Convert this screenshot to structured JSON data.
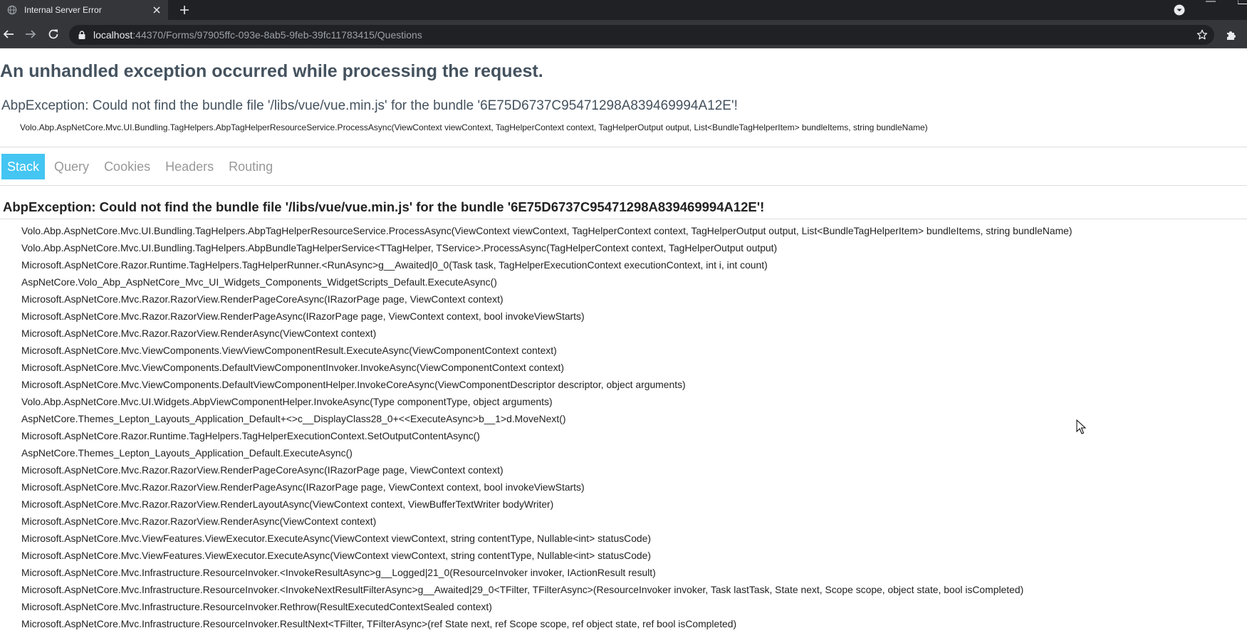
{
  "browser": {
    "tab_title": "Internal Server Error",
    "url_host": "localhost",
    "url_rest": ":44370/Forms/97905ffc-093e-8ab5-9feb-39fc11783415/Questions",
    "icons": [
      "globe-icon",
      "close-icon",
      "plus-icon",
      "tab-search-icon",
      "back-icon",
      "forward-icon",
      "reload-icon",
      "lock-icon",
      "star-icon",
      "extensions-icon"
    ]
  },
  "error": {
    "title": "An unhandled exception occurred while processing the request.",
    "message": "AbpException: Could not find the bundle file '/libs/vue/vue.min.js' for the bundle '6E75D6737C95471298A839469994A12E'!",
    "location": "Volo.Abp.AspNetCore.Mvc.UI.Bundling.TagHelpers.AbpTagHelperResourceService.ProcessAsync(ViewContext viewContext, TagHelperContext context, TagHelperOutput output, List<BundleTagHelperItem> bundleItems, string bundleName)"
  },
  "tabs": [
    "Stack",
    "Query",
    "Cookies",
    "Headers",
    "Routing"
  ],
  "stack": {
    "heading": "AbpException: Could not find the bundle file '/libs/vue/vue.min.js' for the bundle '6E75D6737C95471298A839469994A12E'!",
    "frames": [
      "Volo.Abp.AspNetCore.Mvc.UI.Bundling.TagHelpers.AbpTagHelperResourceService.ProcessAsync(ViewContext viewContext, TagHelperContext context, TagHelperOutput output, List<BundleTagHelperItem> bundleItems, string bundleName)",
      "Volo.Abp.AspNetCore.Mvc.UI.Bundling.TagHelpers.AbpBundleTagHelperService<TTagHelper, TService>.ProcessAsync(TagHelperContext context, TagHelperOutput output)",
      "Microsoft.AspNetCore.Razor.Runtime.TagHelpers.TagHelperRunner.<RunAsync>g__Awaited|0_0(Task task, TagHelperExecutionContext executionContext, int i, int count)",
      "AspNetCore.Volo_Abp_AspNetCore_Mvc_UI_Widgets_Components_WidgetScripts_Default.ExecuteAsync()",
      "Microsoft.AspNetCore.Mvc.Razor.RazorView.RenderPageCoreAsync(IRazorPage page, ViewContext context)",
      "Microsoft.AspNetCore.Mvc.Razor.RazorView.RenderPageAsync(IRazorPage page, ViewContext context, bool invokeViewStarts)",
      "Microsoft.AspNetCore.Mvc.Razor.RazorView.RenderAsync(ViewContext context)",
      "Microsoft.AspNetCore.Mvc.ViewComponents.ViewViewComponentResult.ExecuteAsync(ViewComponentContext context)",
      "Microsoft.AspNetCore.Mvc.ViewComponents.DefaultViewComponentInvoker.InvokeAsync(ViewComponentContext context)",
      "Microsoft.AspNetCore.Mvc.ViewComponents.DefaultViewComponentHelper.InvokeCoreAsync(ViewComponentDescriptor descriptor, object arguments)",
      "Volo.Abp.AspNetCore.Mvc.UI.Widgets.AbpViewComponentHelper.InvokeAsync(Type componentType, object arguments)",
      "AspNetCore.Themes_Lepton_Layouts_Application_Default+<>c__DisplayClass28_0+<<ExecuteAsync>b__1>d.MoveNext()",
      "Microsoft.AspNetCore.Razor.Runtime.TagHelpers.TagHelperExecutionContext.SetOutputContentAsync()",
      "AspNetCore.Themes_Lepton_Layouts_Application_Default.ExecuteAsync()",
      "Microsoft.AspNetCore.Mvc.Razor.RazorView.RenderPageCoreAsync(IRazorPage page, ViewContext context)",
      "Microsoft.AspNetCore.Mvc.Razor.RazorView.RenderPageAsync(IRazorPage page, ViewContext context, bool invokeViewStarts)",
      "Microsoft.AspNetCore.Mvc.Razor.RazorView.RenderLayoutAsync(ViewContext context, ViewBufferTextWriter bodyWriter)",
      "Microsoft.AspNetCore.Mvc.Razor.RazorView.RenderAsync(ViewContext context)",
      "Microsoft.AspNetCore.Mvc.ViewFeatures.ViewExecutor.ExecuteAsync(ViewContext viewContext, string contentType, Nullable<int> statusCode)",
      "Microsoft.AspNetCore.Mvc.ViewFeatures.ViewExecutor.ExecuteAsync(ViewContext viewContext, string contentType, Nullable<int> statusCode)",
      "Microsoft.AspNetCore.Mvc.Infrastructure.ResourceInvoker.<InvokeResultAsync>g__Logged|21_0(ResourceInvoker invoker, IActionResult result)",
      "Microsoft.AspNetCore.Mvc.Infrastructure.ResourceInvoker.<InvokeNextResultFilterAsync>g__Awaited|29_0<TFilter, TFilterAsync>(ResourceInvoker invoker, Task lastTask, State next, Scope scope, object state, bool isCompleted)",
      "Microsoft.AspNetCore.Mvc.Infrastructure.ResourceInvoker.Rethrow(ResultExecutedContextSealed context)",
      "Microsoft.AspNetCore.Mvc.Infrastructure.ResourceInvoker.ResultNext<TFilter, TFilterAsync>(ref State next, ref Scope scope, ref object state, ref bool isCompleted)"
    ]
  },
  "colors": {
    "heading": "#44525e",
    "active_tab": "#44c5f2",
    "inactive_tab": "#999999",
    "chrome_dark": "#202124",
    "chrome_toolbar": "#35363a"
  }
}
